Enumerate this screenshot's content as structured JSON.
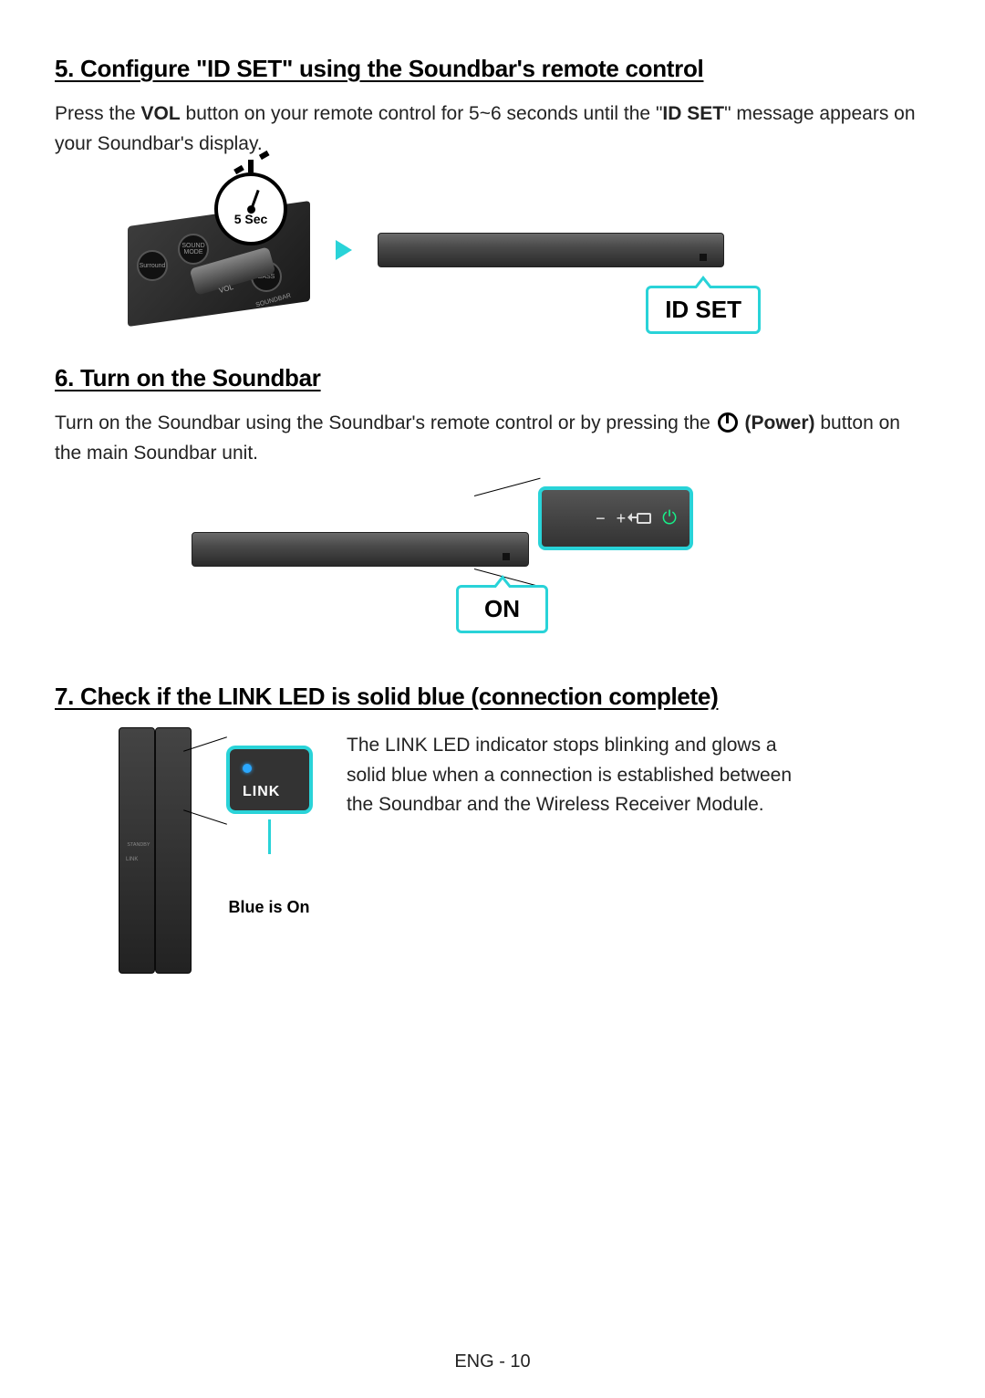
{
  "section5": {
    "heading": "5. Configure \"ID SET\" using the Soundbar's remote control",
    "text_a": "Press the ",
    "vol": "VOL",
    "text_b": " button on your remote control for 5~6 seconds until the \"",
    "idset_inline": "ID SET",
    "text_c": "\" message appears on your Soundbar's display.",
    "stopwatch": "5 Sec",
    "callout": "ID SET",
    "remote_btns": {
      "surround": "Surround",
      "mode": "SOUND MODE",
      "bass": "BASS",
      "vol": "VOL",
      "soundbar": "SOUNDBAR"
    }
  },
  "section6": {
    "heading": "6. Turn on the Soundbar",
    "text_a": "Turn on the Soundbar using the Soundbar's remote control or by pressing the ",
    "power": "(Power)",
    "text_b": " button on the main Soundbar unit.",
    "callout": "ON",
    "panel": {
      "minus": "−",
      "plus": "+"
    }
  },
  "section7": {
    "heading": "7. Check if the LINK LED is solid blue (connection complete)",
    "link": "LINK",
    "blue_on": "Blue is On",
    "text": "The LINK LED indicator stops blinking and glows a solid blue when a connection is established between the Soundbar and the Wireless Receiver Module.",
    "recv_standby": "STANDBY",
    "recv_link": "LINK"
  },
  "footer": "ENG - 10"
}
